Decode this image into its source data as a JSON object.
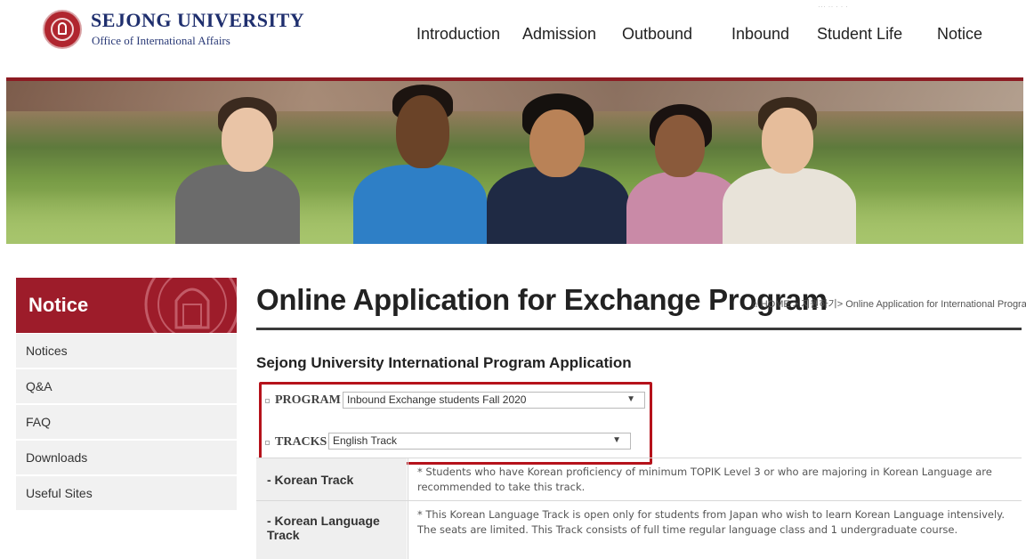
{
  "brand": {
    "title": "SEJONG UNIVERSITY",
    "subtitle": "Office of International Affairs",
    "color": "#1f2f6e"
  },
  "nav": {
    "items": [
      "Introduction",
      "Admission",
      "Outbound",
      "Inbound",
      "Student Life",
      "Notice"
    ]
  },
  "sidebar": {
    "title": "Notice",
    "items": [
      "Notices",
      "Q&A",
      "FAQ",
      "Downloads",
      "Useful Sites"
    ],
    "accent": "#9d1c2a"
  },
  "main": {
    "page_title": "Online Application for Exchange Program",
    "breadcrumb": "HOME > 지원하기> Online Application for International Program",
    "section_title": "Sejong University International Program Application",
    "program_label": "PROGRAM",
    "program_value": "Inbound Exchange students Fall 2020",
    "tracks_label": "TRACKS",
    "tracks_value": "English Track",
    "highlight_color": "#b5121b"
  },
  "tracks_table": [
    {
      "name": "- Korean Track",
      "description": "* Students who have Korean proficiency of minimum TOPIK Level 3 or who are majoring in Korean Language are recommended to take this track."
    },
    {
      "name": "- Korean Language Track",
      "description": "* This Korean Language Track is open only for students from Japan who wish to learn Korean Language intensively. The seats are limited. This Track consists of full time regular language class and 1 undergraduate course."
    }
  ]
}
